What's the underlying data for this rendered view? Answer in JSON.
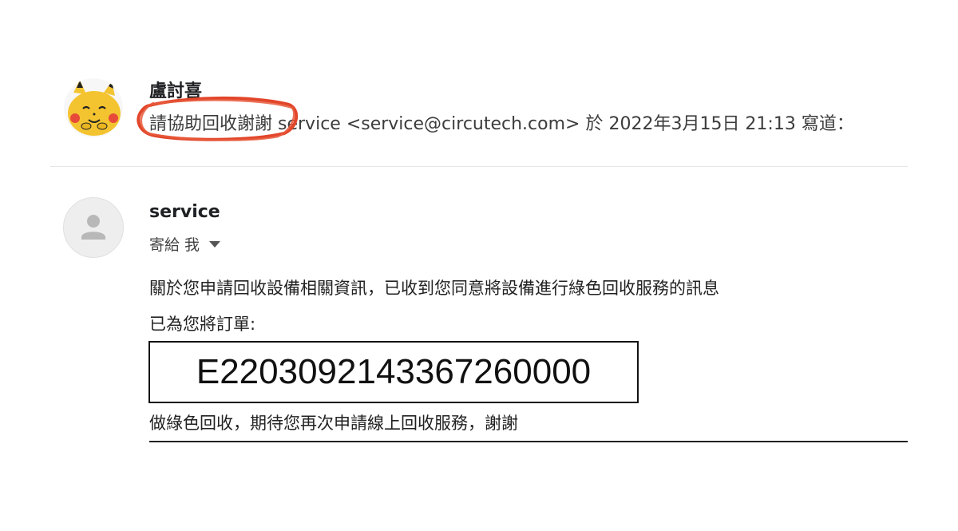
{
  "top_message": {
    "sender_name": "盧討喜",
    "subject_highlight": "請協助回收謝謝",
    "quote_rest": "service <service@circutech.com> 於 2022年3月15日 21:13 寫道：",
    "highlight_color": "#e2462a"
  },
  "message": {
    "sender_name": "service",
    "recipient_label": "寄給 我",
    "body_line_1": "關於您申請回收設備相關資訊，已收到您同意將設備進行綠色回收服務的訊息",
    "body_line_2": "已為您將訂單:",
    "order_number": "E2203092143367260000",
    "body_line_3": "做綠色回收，期待您再次申請線上回收服務，謝謝"
  },
  "icons": {
    "top_avatar": "cartoon-character-avatar",
    "sender_avatar": "person-icon",
    "recipient_dropdown": "caret-down-icon"
  }
}
